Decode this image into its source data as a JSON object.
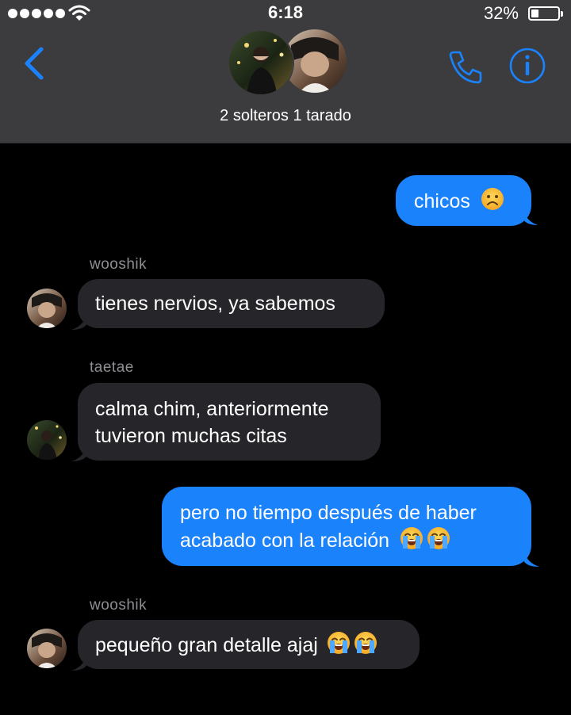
{
  "status_bar": {
    "time": "6:18",
    "battery_percent": "32%",
    "battery_level": 0.32,
    "signal_bars": 5
  },
  "header": {
    "group_name": "2 solteros 1 tarado",
    "back_icon": "chevron-left-icon",
    "call_icon": "phone-icon",
    "info_icon": "info-icon",
    "accent_color": "#1a82fb"
  },
  "messages": [
    {
      "direction": "out",
      "text": "chicos",
      "emoji": [
        "frowning-face"
      ]
    },
    {
      "direction": "in",
      "sender": "wooshik",
      "text": "tienes nervios, ya sabemos"
    },
    {
      "direction": "in",
      "sender": "taetae",
      "lines": [
        "calma chim, anteriormente",
        "tuvieron muchas citas"
      ]
    },
    {
      "direction": "out",
      "lines": [
        "pero no tiempo después de haber",
        "acabado con la relación"
      ],
      "emoji": [
        "loudly-crying-face",
        "loudly-crying-face"
      ]
    },
    {
      "direction": "in",
      "sender": "wooshik",
      "text": "pequeño gran detalle ajaj",
      "emoji": [
        "loudly-crying-face",
        "loudly-crying-face"
      ]
    }
  ],
  "colors": {
    "outgoing_bubble": "#1a82fb",
    "incoming_bubble": "#26252a",
    "header_bg": "#3c3c3e",
    "background": "#000000"
  }
}
